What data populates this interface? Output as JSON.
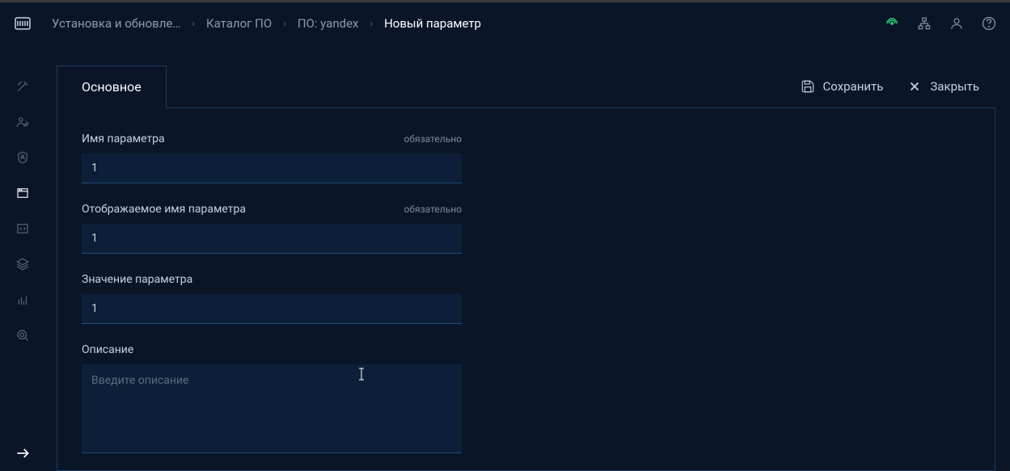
{
  "breadcrumb": {
    "items": [
      {
        "label": "Установка и обновле…"
      },
      {
        "label": "Каталог ПО"
      },
      {
        "label": "ПО: yandex"
      },
      {
        "label": "Новый параметр"
      }
    ]
  },
  "tabs": {
    "main": "Основное"
  },
  "actions": {
    "save": "Сохранить",
    "close": "Закрыть"
  },
  "form": {
    "required_label": "обязательно",
    "name": {
      "label": "Имя параметра",
      "value": "1"
    },
    "display_name": {
      "label": "Отображаемое имя параметра",
      "value": "1"
    },
    "value": {
      "label": "Значение параметра",
      "value": "1"
    },
    "description": {
      "label": "Описание",
      "placeholder": "Введите описание",
      "value": ""
    }
  }
}
